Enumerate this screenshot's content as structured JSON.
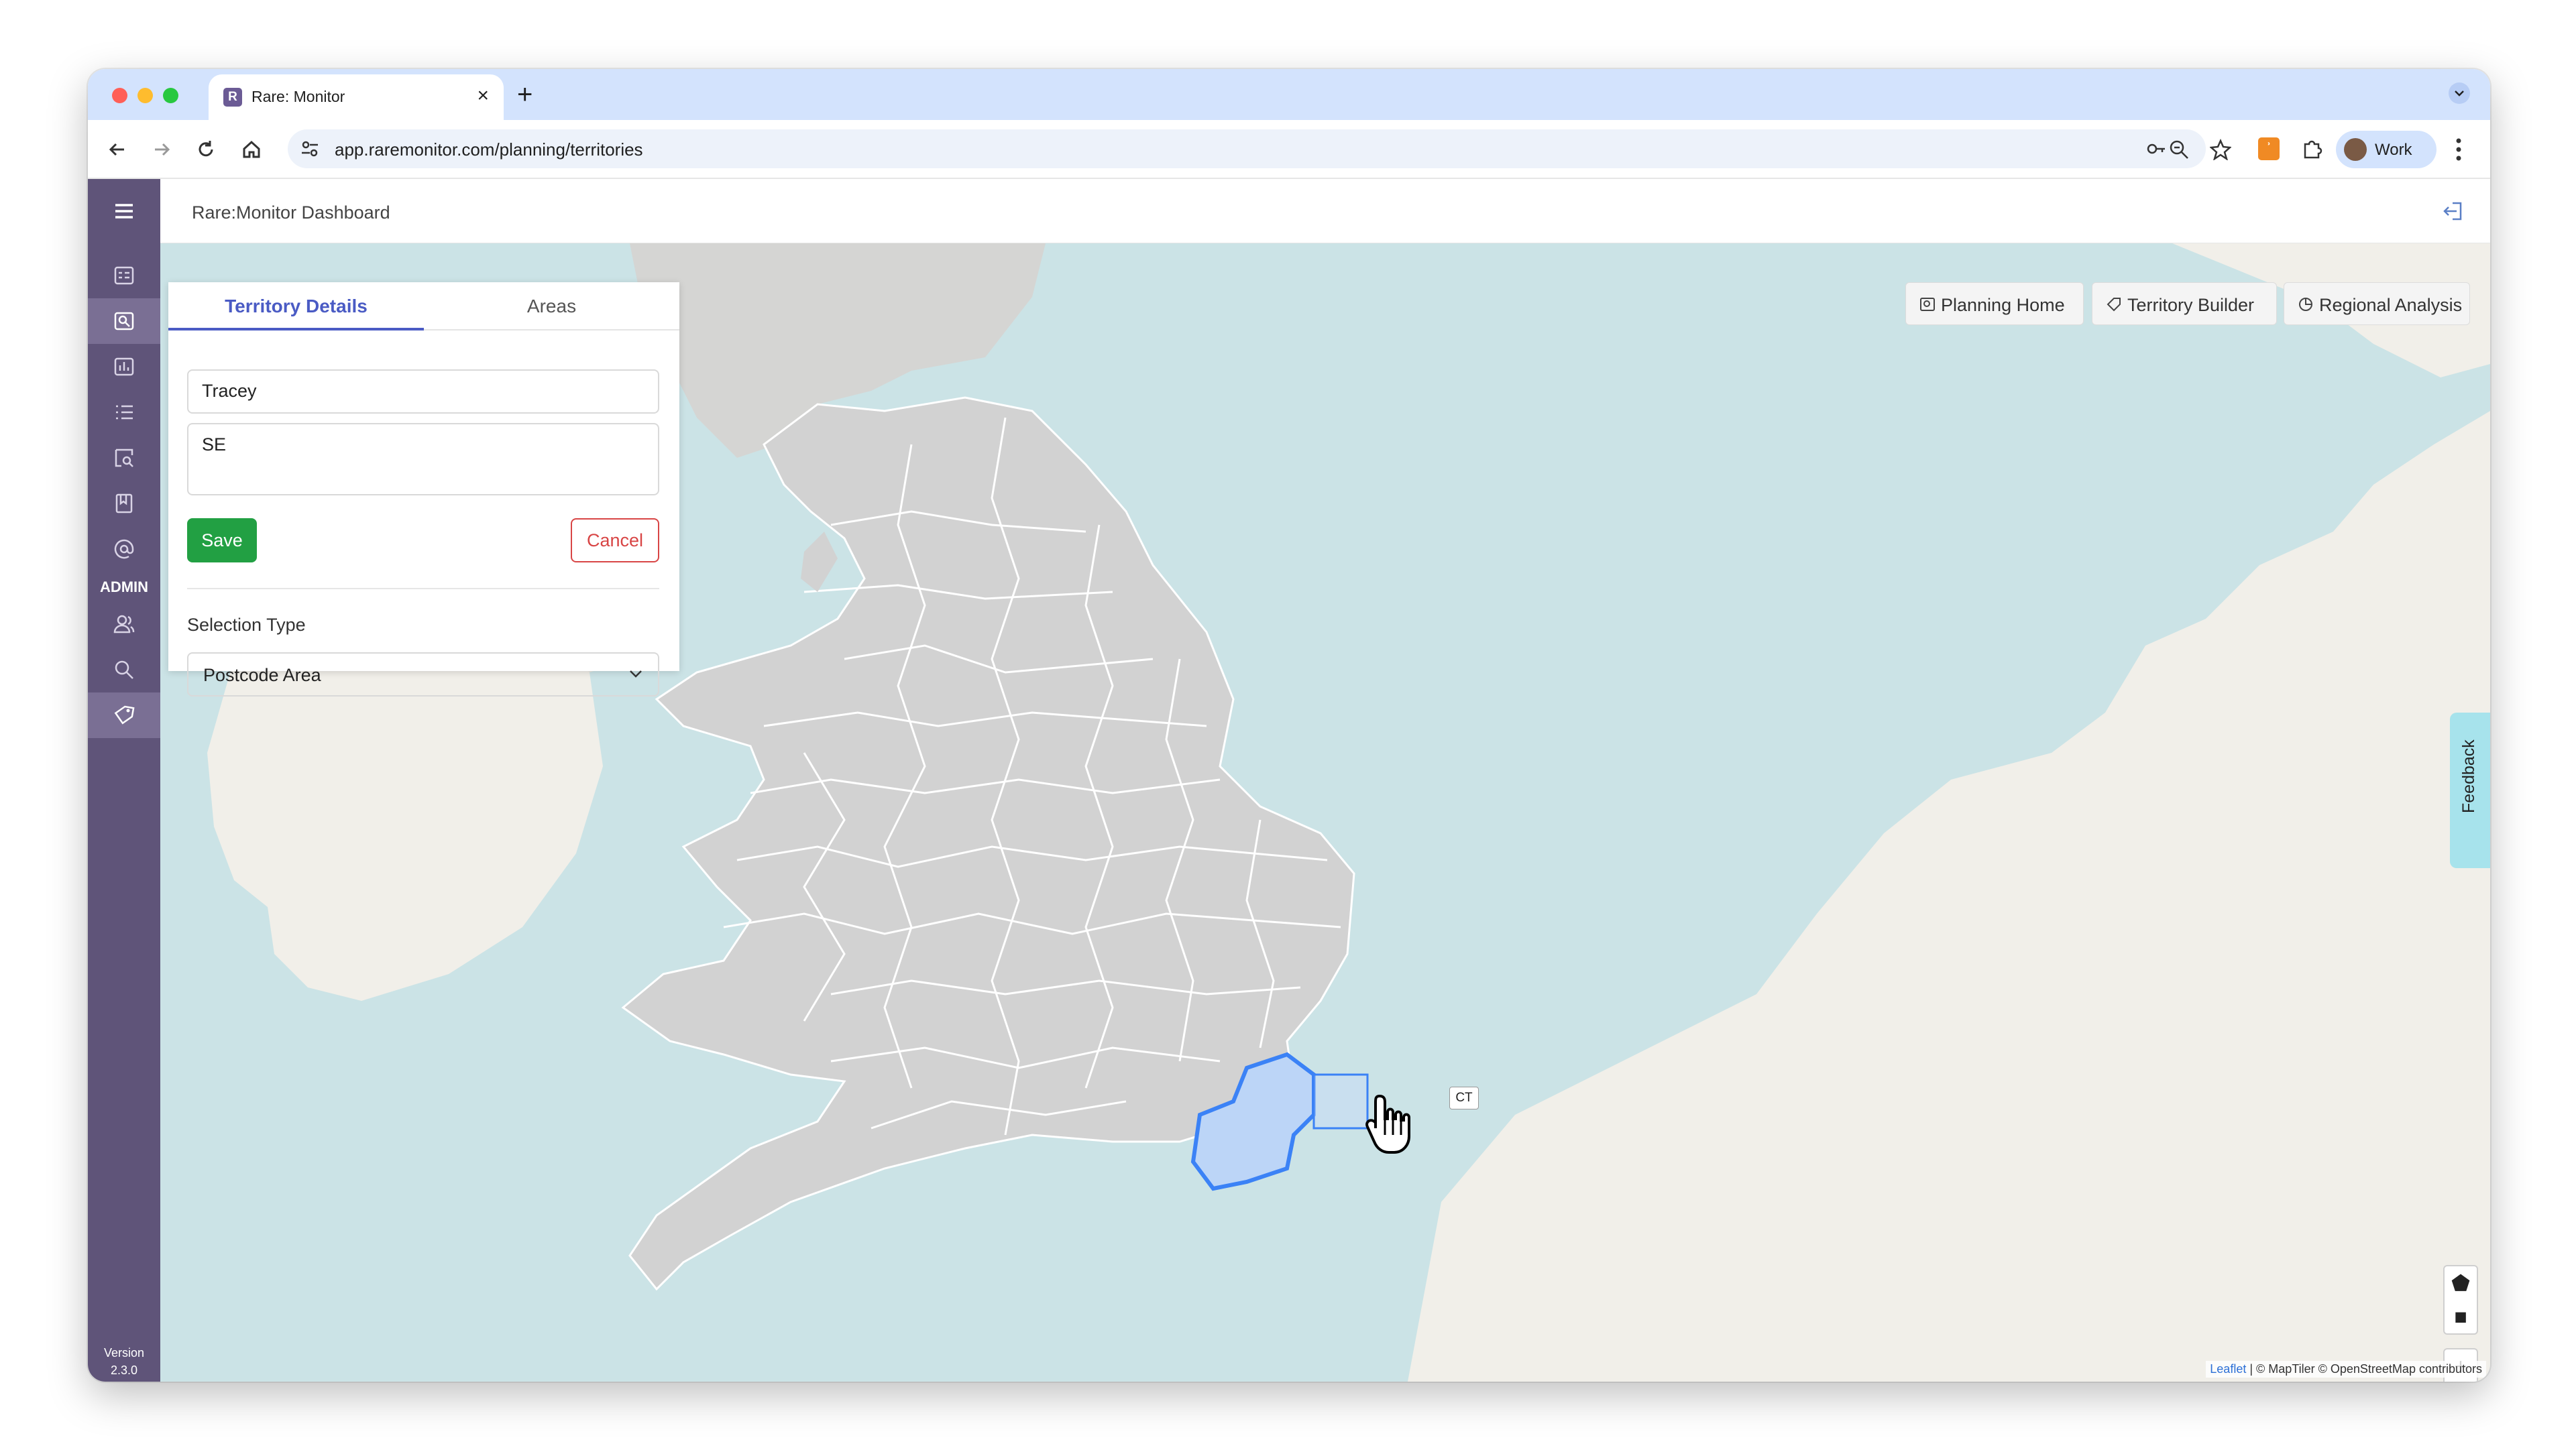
{
  "browser": {
    "tab_title": "Rare: Monitor",
    "tab_favicon": "R",
    "url": "app.raremonitor.com/planning/territories",
    "profile_label": "Work"
  },
  "app": {
    "header_title": "Rare:Monitor Dashboard",
    "sidebar": {
      "admin_label": "ADMIN",
      "version_label": "Version",
      "version_number": "2.3.0"
    }
  },
  "map_controls": {
    "planning_home": "Planning Home",
    "territory_builder": "Territory Builder",
    "regional_analysis": "Regional Analysis",
    "feedback": "Feedback",
    "zoom_in": "+",
    "zoom_out": "−",
    "attribution_leaflet": "Leaflet",
    "attribution_rest": " | © MapTiler © OpenStreetMap contributors",
    "tooltip": "CT"
  },
  "panel": {
    "tab_details": "Territory Details",
    "tab_areas": "Areas",
    "name_value": "Tracey",
    "description_value": "SE",
    "save_label": "Save",
    "cancel_label": "Cancel",
    "selection_type_label": "Selection Type",
    "selection_type_value": "Postcode Area"
  },
  "colors": {
    "sidebar": "#5f5479",
    "tab_active": "#4a5bc4",
    "save": "#22a043",
    "cancel": "#d84545",
    "selected_region": "#3b82f6"
  }
}
